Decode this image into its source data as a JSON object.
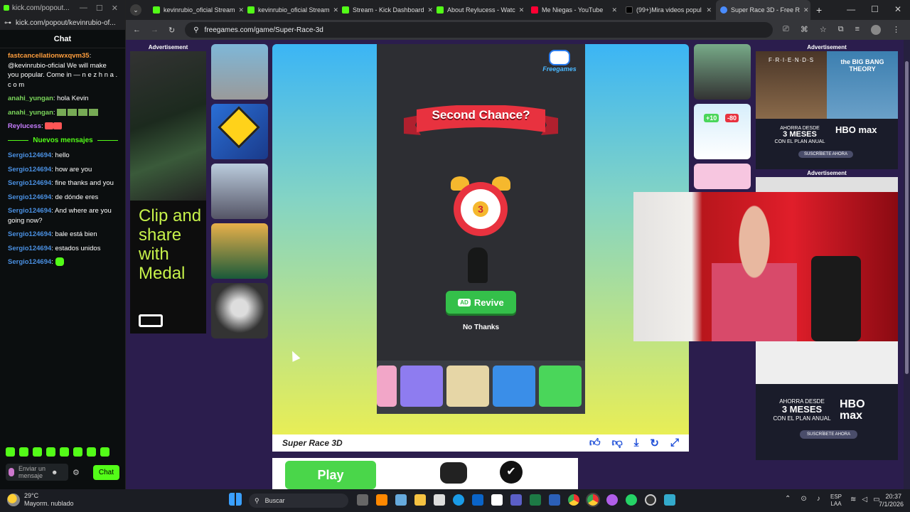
{
  "kick_window": {
    "title": "kick.com/popout...",
    "url": "kick.com/popout/kevinrubio-of...",
    "chat_header": "Chat",
    "messages": [
      {
        "user": "fastcancellationwxqvm35",
        "text": "@kevinrubio-oficial We will make you popular. Come in — n e z h n a . c o m",
        "color": "orange"
      },
      {
        "user": "anahi_yungan",
        "text": "hola Kevin",
        "color": "green"
      },
      {
        "user": "anahi_yungan",
        "text": "",
        "color": "green"
      },
      {
        "user": "Reylucess",
        "text": "",
        "color": "purple"
      }
    ],
    "new_messages_divider": "Nuevos mensajes",
    "new_messages": [
      {
        "user": "Sergio124694",
        "text": "hello"
      },
      {
        "user": "Sergio124694",
        "text": "how are you"
      },
      {
        "user": "Sergio124694",
        "text": "fine thanks and you"
      },
      {
        "user": "Sergio124694",
        "text": "de dónde eres"
      },
      {
        "user": "Sergio124694",
        "text": "And where are you going now?"
      },
      {
        "user": "Sergio124694",
        "text": "bale está bien"
      },
      {
        "user": "Sergio124694",
        "text": "estados unidos"
      },
      {
        "user": "Sergio124694",
        "text": ""
      }
    ],
    "input_placeholder": "Enviar un mensaje",
    "chat_button": "Chat"
  },
  "tabs": [
    {
      "label": "kevinrubio_oficial Stream",
      "color": "#53fc18"
    },
    {
      "label": "kevinrubio_oficial Stream",
      "color": "#53fc18"
    },
    {
      "label": "Stream - Kick Dashboard",
      "color": "#53fc18"
    },
    {
      "label": "About Reylucess - Watc",
      "color": "#53fc18"
    },
    {
      "label": "Me Niegas - YouTube",
      "color": "#ff0033"
    },
    {
      "label": "(99+)Mira videos popul",
      "color": "#111111"
    },
    {
      "label": "Super Race 3D - Free R",
      "color": "#4a8cff",
      "active": true
    }
  ],
  "address": {
    "url": "freegames.com/game/Super-Race-3d"
  },
  "ads": {
    "advertisement_label": "Advertisement",
    "medal_text": "Clip and share with Medal",
    "hbo_text_1": "AHORRA DESDE",
    "hbo_text_2": "3 MESES",
    "hbo_text_3": "CON EL PLAN ANUAL",
    "hbo_brand": "HBO max",
    "hbo_cta": "SUSCRÍBETE AHORA",
    "friends": "F·R·I·E·N·D·S",
    "bigbang": "the BIG BANG THEORY",
    "play_button": "Play"
  },
  "game": {
    "title": "Super Race 3D",
    "logo": "Freegames",
    "banner": "Second Chance?",
    "countdown": "3",
    "revive_badge": "AD",
    "revive": "Revive",
    "no_thanks": "No Thanks",
    "thumb_labels": [
      "+10",
      "-80"
    ]
  },
  "taskbar": {
    "temp": "29°C",
    "weather": "Mayorm. nublado",
    "search": "Buscar",
    "lang": "ESP",
    "lang2": "LAA",
    "time": "20:37",
    "date": "7/1/2026"
  }
}
